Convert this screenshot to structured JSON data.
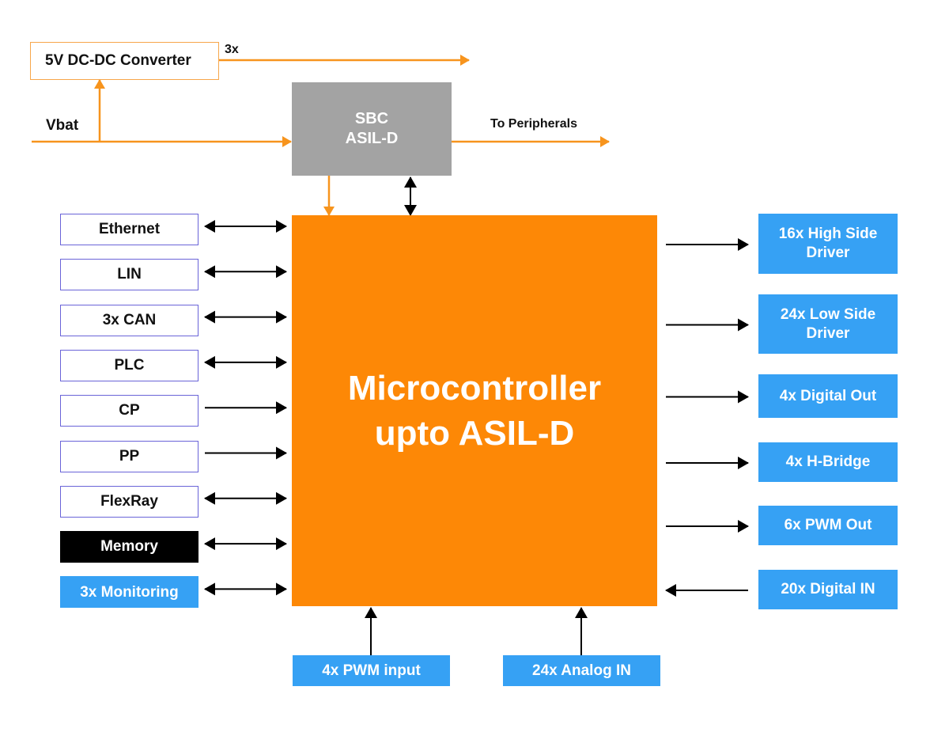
{
  "colors": {
    "orange": "#fd8806",
    "power_line": "#f7941d",
    "blue": "#36a1f4",
    "gray": "#a3a3a3",
    "interface_border": "#6a64d8",
    "black": "#000000"
  },
  "power": {
    "converter_label": "5V DC-DC Converter",
    "converter_output_label": "3x",
    "vbat_label": "Vbat",
    "peripherals_label": "To Peripherals"
  },
  "sbc": {
    "line1": "SBC",
    "line2": "ASIL-D"
  },
  "mcu": {
    "line1": "Microcontroller",
    "line2": "upto ASIL-D"
  },
  "left_interfaces": [
    {
      "label": "Ethernet",
      "direction": "bidirectional",
      "style": "outline"
    },
    {
      "label": "LIN",
      "direction": "bidirectional",
      "style": "outline"
    },
    {
      "label": "3x CAN",
      "direction": "bidirectional",
      "style": "outline"
    },
    {
      "label": "PLC",
      "direction": "bidirectional",
      "style": "outline"
    },
    {
      "label": "CP",
      "direction": "to-mcu",
      "style": "outline"
    },
    {
      "label": "PP",
      "direction": "to-mcu",
      "style": "outline"
    },
    {
      "label": "FlexRay",
      "direction": "bidirectional",
      "style": "outline"
    },
    {
      "label": "Memory",
      "direction": "bidirectional",
      "style": "black"
    },
    {
      "label": "3x Monitoring",
      "direction": "bidirectional",
      "style": "blue"
    }
  ],
  "right_interfaces": [
    {
      "line1": "16x High Side",
      "line2": "Driver",
      "direction": "from-mcu"
    },
    {
      "line1": "24x Low Side",
      "line2": "Driver",
      "direction": "from-mcu"
    },
    {
      "line1": "4x Digital Out",
      "line2": "",
      "direction": "from-mcu"
    },
    {
      "line1": "4x H-Bridge",
      "line2": "",
      "direction": "from-mcu"
    },
    {
      "line1": "6x PWM Out",
      "line2": "",
      "direction": "from-mcu"
    },
    {
      "line1": "20x Digital IN",
      "line2": "",
      "direction": "to-mcu"
    }
  ],
  "bottom_interfaces": [
    {
      "label": "4x PWM input",
      "direction": "to-mcu"
    },
    {
      "label": "24x Analog IN",
      "direction": "to-mcu"
    }
  ]
}
